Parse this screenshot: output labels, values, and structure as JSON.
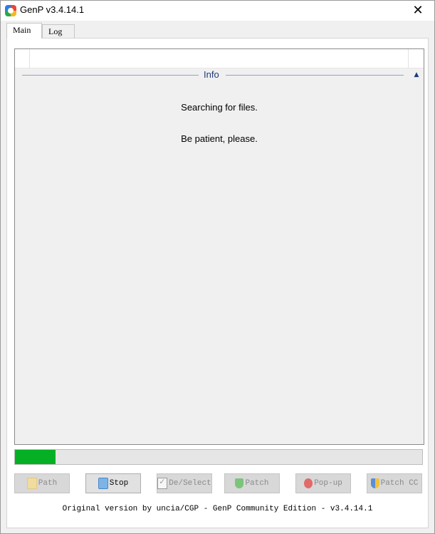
{
  "window": {
    "title": "GenP v3.4.14.1",
    "close_glyph": "✕"
  },
  "tabs": [
    {
      "label": "Main",
      "active": true
    },
    {
      "label": "Log",
      "active": false
    }
  ],
  "info": {
    "header": "Info",
    "collapse_glyph": "▲",
    "line1": "Searching for files.",
    "line2": "Be patient, please."
  },
  "progress": {
    "percent": 10,
    "color": "#06b025"
  },
  "buttons": [
    {
      "label": "Path",
      "icon": "folder-icon",
      "enabled": false
    },
    {
      "label": "Stop",
      "icon": "stop-icon",
      "enabled": true
    },
    {
      "label": "De/Select",
      "icon": "checkbox-icon",
      "enabled": false
    },
    {
      "label": "Patch",
      "icon": "shield-check-icon",
      "enabled": false
    },
    {
      "label": "Pop-up",
      "icon": "shield-x-icon",
      "enabled": false
    },
    {
      "label": "Patch CC",
      "icon": "shield-icon",
      "enabled": false
    }
  ],
  "footer": "Original version by uncia/CGP - GenP Community Edition - v3.4.14.1"
}
